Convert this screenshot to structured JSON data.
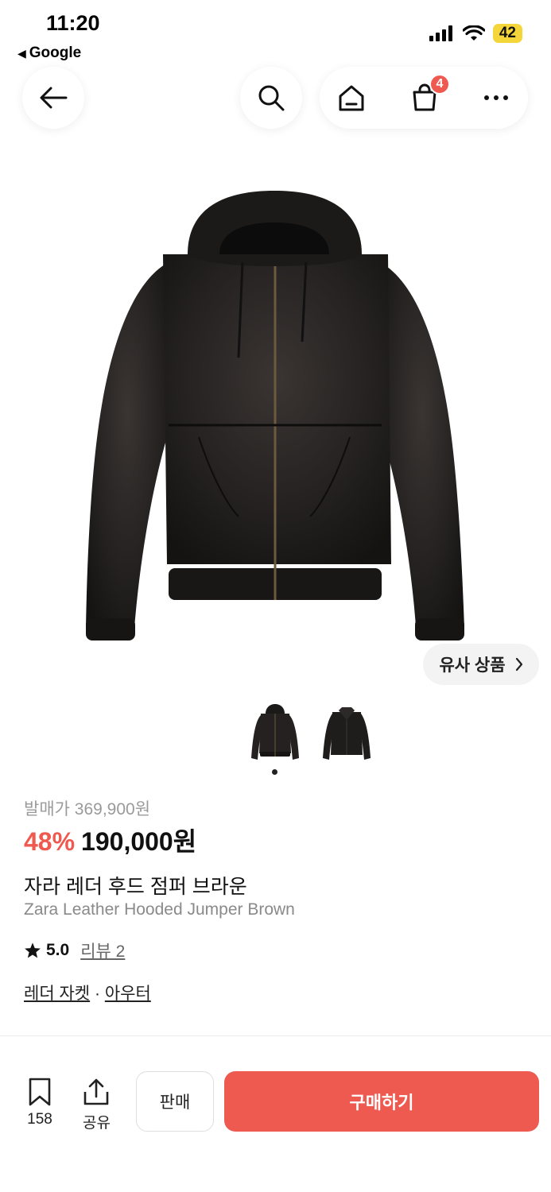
{
  "status_bar": {
    "time": "11:20",
    "back_app": "Google",
    "battery": "42"
  },
  "header": {
    "cart_count": "4",
    "icons": [
      "back-arrow-icon",
      "search-icon",
      "home-icon",
      "cart-bag-icon",
      "more-icon"
    ]
  },
  "product": {
    "similar_label": "유사 상품",
    "original_price": "발매가 369,900원",
    "discount": "48%",
    "price": "190,000원",
    "name_ko": "자라 레더 후드 점퍼 브라운",
    "name_en": "Zara Leather Hooded Jumper Brown",
    "rating": "5.0",
    "reviews": "리뷰 2",
    "category_1": "레더 자켓",
    "category_sep": "·",
    "category_2": "아우터",
    "thumbnail_count": 2,
    "active_thumbnail": 1
  },
  "bottom_bar": {
    "bookmark_count": "158",
    "share_label": "공유",
    "sell_label": "판매",
    "buy_label": "구매하기"
  },
  "colors": {
    "accent": "#ee5a4f",
    "battery": "#f5d63a"
  }
}
